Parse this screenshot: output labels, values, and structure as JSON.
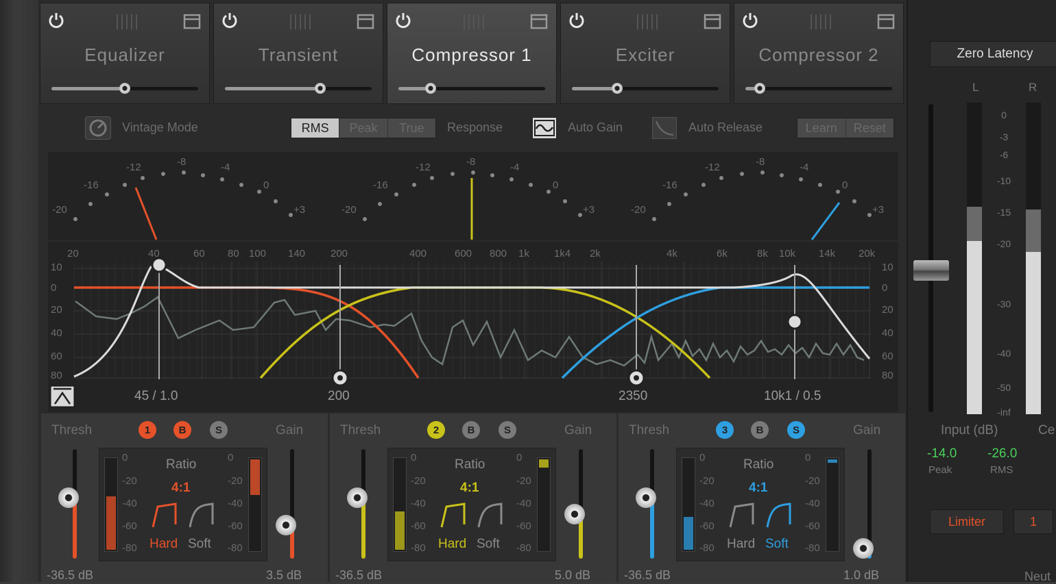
{
  "modules": [
    {
      "name": "Equalizer",
      "active": false,
      "slider": 0.5
    },
    {
      "name": "Transient",
      "active": false,
      "slider": 0.65
    },
    {
      "name": "Compressor 1",
      "active": true,
      "slider": 0.22
    },
    {
      "name": "Exciter",
      "active": false,
      "slider": 0.31
    },
    {
      "name": "Compressor 2",
      "active": false,
      "slider": 0.1
    }
  ],
  "toolbar": {
    "vintage_mode": "Vintage Mode",
    "detect": [
      "RMS",
      "Peak",
      "True"
    ],
    "detect_selected": "RMS",
    "response": "Response",
    "auto_gain": "Auto Gain",
    "auto_release": "Auto Release",
    "learn": "Learn",
    "reset": "Reset"
  },
  "graph": {
    "meter_labels": {
      "m20": "-20",
      "m16": "-16",
      "m12": "-12",
      "m8": "-8",
      "m4": "-4",
      "z": "0",
      "p3": "+3"
    },
    "freq_ticks": [
      "20",
      "40",
      "60",
      "80",
      "100",
      "140",
      "200",
      "400",
      "600",
      "800",
      "1k",
      "1k4",
      "2k",
      "4k",
      "6k",
      "8k",
      "10k",
      "14k",
      "20k"
    ],
    "db_ticks": [
      "10",
      "0",
      "20",
      "40",
      "60",
      "80"
    ],
    "markers": {
      "low": "45 / 1.0",
      "x1": "200",
      "x2": "2350",
      "high": "10k1 / 0.5"
    }
  },
  "bands": [
    {
      "num": "1",
      "b": "B",
      "s": "S",
      "color": "#e5522a",
      "thresh_label": "Thresh",
      "gain_label": "Gain",
      "ratio_label": "Ratio",
      "ratio": "4:1",
      "hard": "Hard",
      "soft": "Soft",
      "knee": "Hard",
      "thresh_value": "-36.5 dB",
      "gain_value": "3.5 dB",
      "scale": [
        "0",
        "-20",
        "-40",
        "-60",
        "-80"
      ]
    },
    {
      "num": "2",
      "b": "B",
      "s": "S",
      "color": "#c9c21a",
      "thresh_label": "Thresh",
      "gain_label": "Gain",
      "ratio_label": "Ratio",
      "ratio": "4:1",
      "hard": "Hard",
      "soft": "Soft",
      "knee": "Hard",
      "thresh_value": "-36.5 dB",
      "gain_value": "5.0 dB",
      "scale": [
        "0",
        "-20",
        "-40",
        "-60",
        "-80"
      ]
    },
    {
      "num": "3",
      "b": "B",
      "s": "S",
      "color": "#2e9fe0",
      "thresh_label": "Thresh",
      "gain_label": "Gain",
      "ratio_label": "Ratio",
      "ratio": "4:1",
      "hard": "Hard",
      "soft": "Soft",
      "knee": "Soft",
      "thresh_value": "-36.5 dB",
      "gain_value": "1.0 dB",
      "scale": [
        "0",
        "-20",
        "-40",
        "-60",
        "-80"
      ]
    }
  ],
  "right": {
    "zero_latency": "Zero Latency",
    "l": "L",
    "r": "R",
    "scale": [
      "0",
      "-3",
      "-6",
      "-10",
      "-15",
      "-20",
      "-30",
      "-40",
      "-50",
      "-inf"
    ],
    "input_label": "Input (dB)",
    "cut_label": "Ce",
    "peak_value": "-14.0",
    "peak_label": "Peak",
    "rms_value": "-26.0",
    "rms_label": "RMS",
    "limiter": "Limiter",
    "limiter_value": "1",
    "neutral": "Neut"
  }
}
